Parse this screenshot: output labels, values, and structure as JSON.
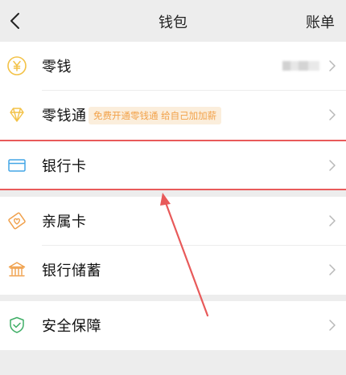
{
  "header": {
    "back_icon": "back-chevron-icon",
    "title": "钱包",
    "action_label": "账单"
  },
  "groups": [
    {
      "items": [
        {
          "label": "零钱",
          "icon": "yuan-coin-icon",
          "value_blurred": true
        },
        {
          "label": "零钱通",
          "icon": "diamond-icon",
          "promo": "免费开通零钱通 给自己加加薪"
        }
      ]
    },
    {
      "items": [
        {
          "label": "银行卡",
          "icon": "bank-card-icon",
          "highlighted": true
        }
      ]
    },
    {
      "items": [
        {
          "label": "亲属卡",
          "icon": "family-card-icon"
        },
        {
          "label": "银行储蓄",
          "icon": "bank-building-icon"
        }
      ]
    },
    {
      "items": [
        {
          "label": "安全保障",
          "icon": "shield-check-icon"
        }
      ]
    }
  ],
  "colors": {
    "background": "#ededed",
    "row_background": "#ffffff",
    "highlight": "#e85a5a",
    "promo_text": "#f2a24a",
    "promo_background": "#fbeedc",
    "icon_yellow": "#f3c247",
    "icon_blue": "#43a6e6",
    "icon_orange": "#f0a04b",
    "icon_green": "#3fae66"
  }
}
